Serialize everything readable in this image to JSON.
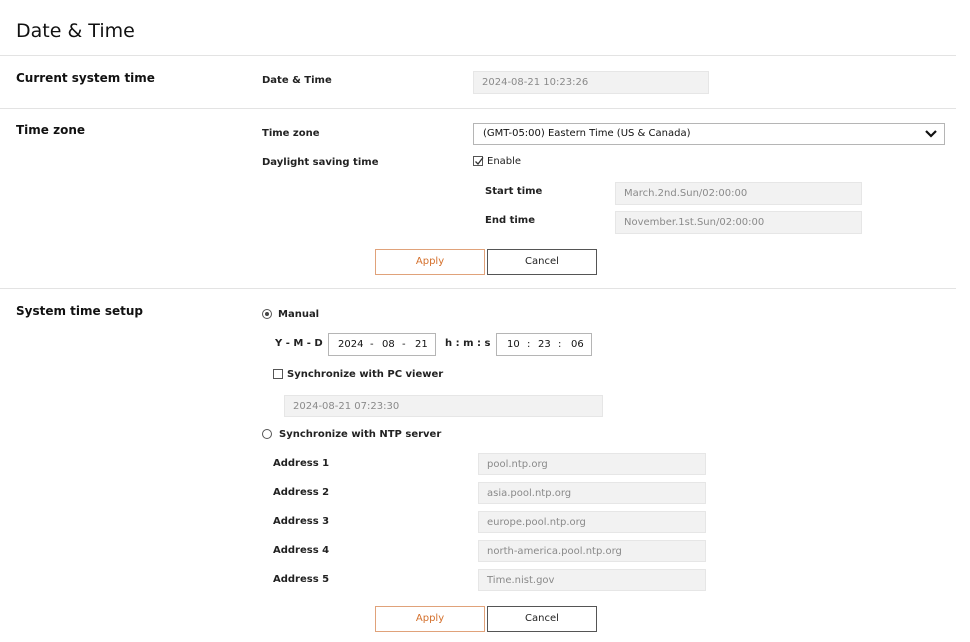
{
  "page_title": "Date & Time",
  "current": {
    "section_title": "Current system time",
    "label": "Date & Time",
    "value": "2024-08-21 10:23:26"
  },
  "timezone": {
    "section_title": "Time zone",
    "tz_label": "Time zone",
    "tz_value": "(GMT-05:00) Eastern Time (US & Canada)",
    "dst_label": "Daylight saving time",
    "dst_enable_label": "Enable",
    "dst_enabled": true,
    "start_label": "Start time",
    "start_value": "March.2nd.Sun/02:00:00",
    "end_label": "End time",
    "end_value": "November.1st.Sun/02:00:00",
    "apply_label": "Apply",
    "cancel_label": "Cancel"
  },
  "setup": {
    "section_title": "System time setup",
    "manual_label": "Manual",
    "manual_selected": true,
    "ymd_label": "Y - M - D",
    "year": "2024",
    "month": "08",
    "day": "21",
    "date_sep": "-",
    "hms_label": "h : m : s",
    "hour": "10",
    "minute": "23",
    "second": "06",
    "time_sep": ":",
    "sync_pc_label": "Synchronize with PC viewer",
    "pc_time": "2024-08-21 07:23:30",
    "ntp_label": "Synchronize with NTP server",
    "ntp_selected": false,
    "addresses": [
      {
        "label": "Address 1",
        "value": "pool.ntp.org"
      },
      {
        "label": "Address 2",
        "value": "asia.pool.ntp.org"
      },
      {
        "label": "Address 3",
        "value": "europe.pool.ntp.org"
      },
      {
        "label": "Address 4",
        "value": "north-america.pool.ntp.org"
      },
      {
        "label": "Address 5",
        "value": "Time.nist.gov"
      }
    ],
    "apply_label": "Apply",
    "cancel_label": "Cancel"
  },
  "colors": {
    "accent": "#d4702c",
    "field_bg": "#f2f2f2",
    "divider": "#e3e3e3"
  }
}
